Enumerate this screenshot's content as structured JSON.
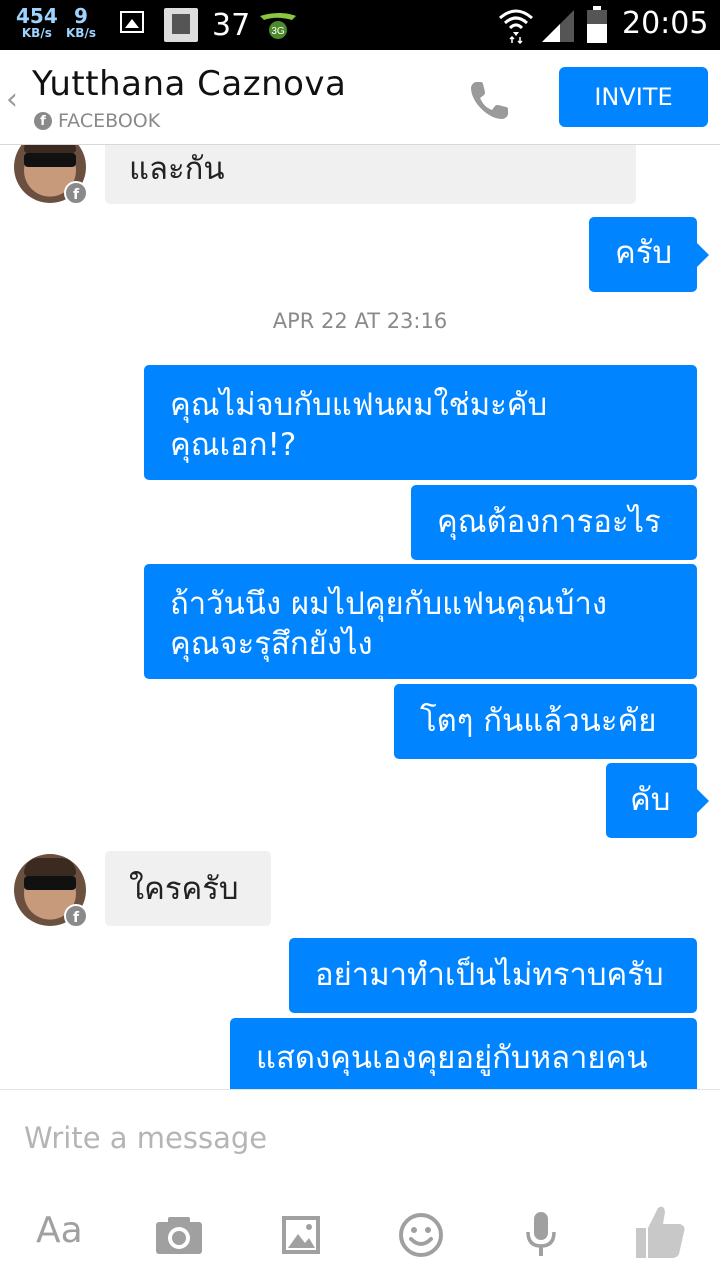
{
  "status_bar": {
    "net_down": "454",
    "net_down_unit": "KB/s",
    "net_up": "9",
    "net_up_unit": "KB/s",
    "notification_count": "37",
    "network_type": "3G",
    "time": "20:05",
    "icons": [
      "image-icon",
      "app-notification-icon",
      "3g-icon",
      "wifi-icon",
      "signal-icon",
      "battery-icon"
    ]
  },
  "header": {
    "back_label": "‹",
    "contact_name": "Yutthana Caznova",
    "source_label": "FACEBOOK",
    "invite_label": "INVITE",
    "call_icon": "phone-icon"
  },
  "messages": [
    {
      "direction": "in",
      "text": "และกัน"
    },
    {
      "direction": "out",
      "text": "ครับ"
    },
    {
      "type": "timestamp",
      "text": "APR 22 AT 23:16"
    },
    {
      "direction": "out",
      "lines": [
        "คุณไม่จบกับแฟนผมใช่มะคับ",
        "คุณเอก!?"
      ]
    },
    {
      "direction": "out",
      "text": "คุณต้องการอะไร"
    },
    {
      "direction": "out",
      "lines": [
        "ถ้าวันนึง ผมไปคุยกับแฟนคุณบ้าง",
        "คุณจะรุสึกยังไง"
      ]
    },
    {
      "direction": "out",
      "text": "โตๆ กันแล้วนะคัย"
    },
    {
      "direction": "out",
      "text": "คับ"
    },
    {
      "direction": "in",
      "text": "ใครครับ"
    },
    {
      "direction": "out",
      "text": "อย่ามาทำเป็นไม่ทราบครับ"
    },
    {
      "direction": "out",
      "text": "แสดงคุนเองคุยอยู่กับหลายคน"
    }
  ],
  "composer": {
    "placeholder": "Write a message",
    "text_format_label": "Aa",
    "tools": [
      "camera-icon",
      "gallery-icon",
      "emoji-icon",
      "microphone-icon",
      "like-icon"
    ]
  },
  "colors": {
    "accent": "#0084ff",
    "incoming_bubble": "#f1f0f0",
    "muted_text": "#8a8a8a"
  }
}
